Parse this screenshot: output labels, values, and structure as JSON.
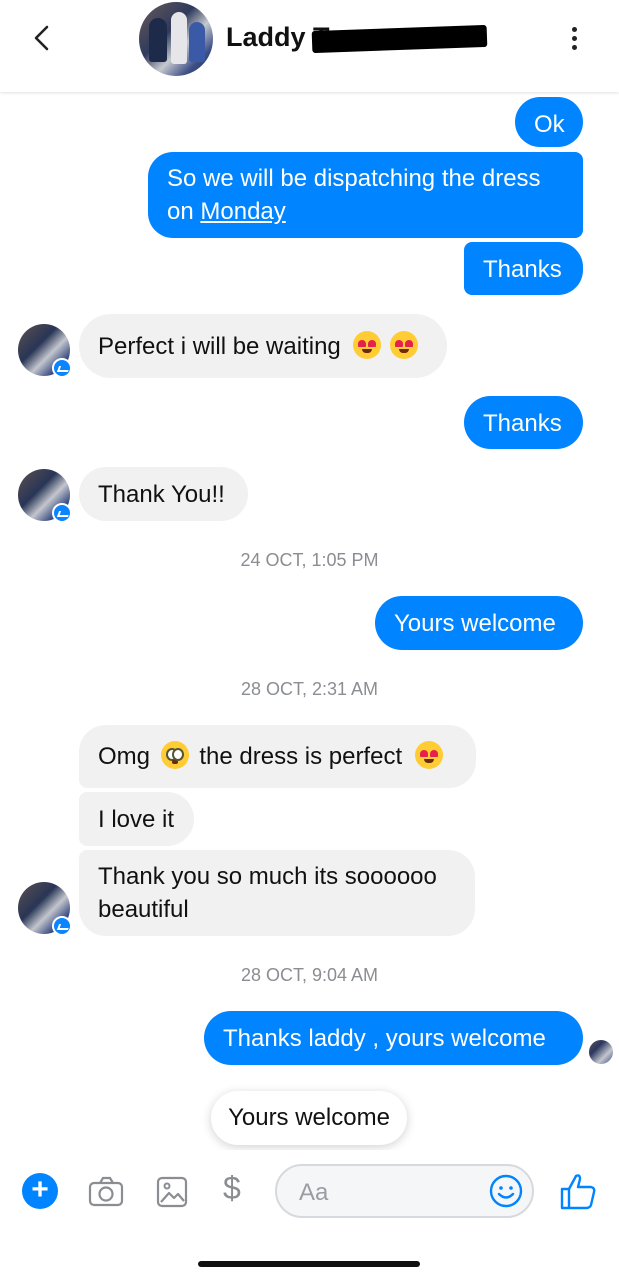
{
  "header": {
    "contact_name": "Laddy To",
    "icons": [
      "chevron-left-icon",
      "avatar",
      "more-vertical-icon"
    ]
  },
  "messages": {
    "m1": "Ok",
    "m2_line1": "So we will be dispatching the dress",
    "m2_line2_prefix": "on ",
    "m2_link": "Monday",
    "m3": "Thanks",
    "m4": "Perfect i will be waiting",
    "m5": "Thanks",
    "m6": "Thank You!!",
    "ts1": "24 OCT, 1:05 PM",
    "m7": "Yours welcome",
    "ts2": "28 OCT, 2:31 AM",
    "m8_a": "Omg",
    "m8_b": "the dress is perfect",
    "m9": "I love it",
    "m10_line1": "Thank you so much its soooooo",
    "m10_line2": "beautiful",
    "ts3": "28 OCT, 9:04 AM",
    "m11": "Thanks laddy , yours welcome"
  },
  "reply_suggestion": "Yours welcome",
  "composer": {
    "placeholder": "Aa",
    "dollar": "$",
    "plus": "+"
  },
  "colors": {
    "outgoing": "#0084ff",
    "incoming": "#f1f1f1",
    "timestamp": "#8a8d91"
  }
}
